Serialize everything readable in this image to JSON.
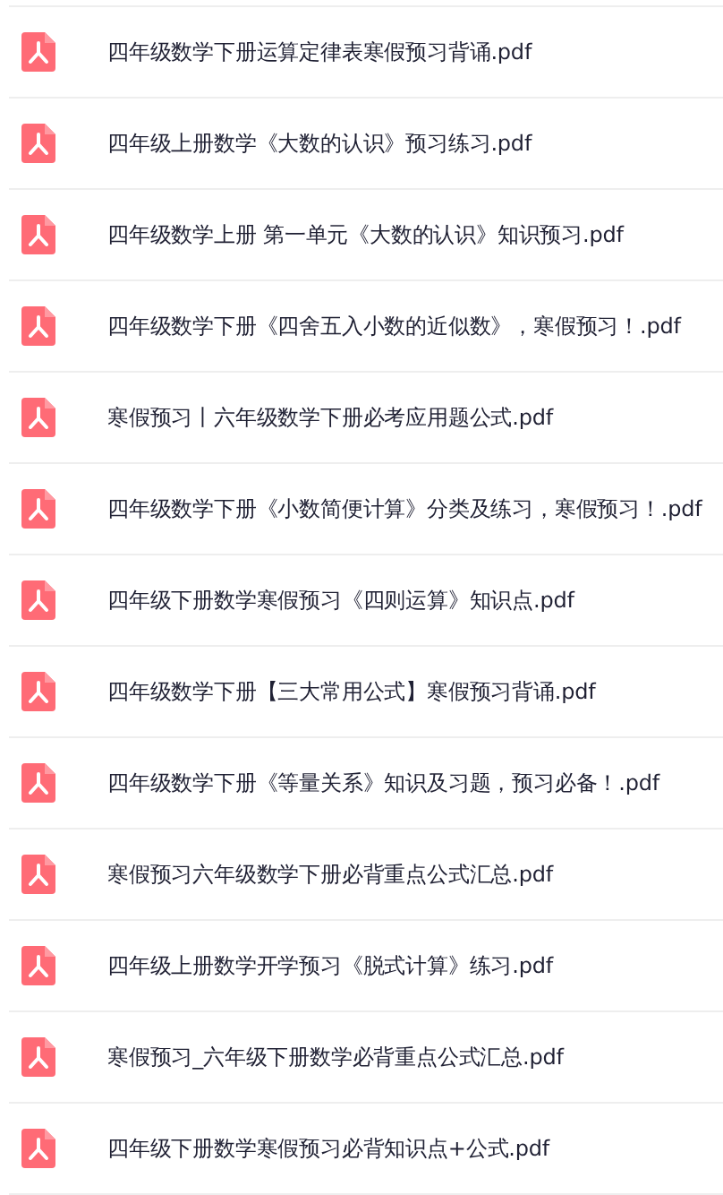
{
  "files": [
    {
      "name": "四年级数学下册运算定律表寒假预习背诵.pdf"
    },
    {
      "name": "四年级上册数学《大数的认识》预习练习.pdf"
    },
    {
      "name": "四年级数学上册 第一单元《大数的认识》知识预习.pdf"
    },
    {
      "name": "四年级数学下册《四舍五入小数的近似数》，寒假预习！.pdf"
    },
    {
      "name": "寒假预习丨六年级数学下册必考应用题公式.pdf"
    },
    {
      "name": "四年级数学下册《小数简便计算》分类及练习，寒假预习！.pdf"
    },
    {
      "name": "四年级下册数学寒假预习《四则运算》知识点.pdf"
    },
    {
      "name": "四年级数学下册【三大常用公式】寒假预习背诵.pdf"
    },
    {
      "name": "四年级数学下册《等量关系》知识及习题，预习必备！.pdf"
    },
    {
      "name": "寒假预习六年级数学下册必背重点公式汇总.pdf"
    },
    {
      "name": "四年级上册数学开学预习《脱式计算》练习.pdf"
    },
    {
      "name": "寒假预习_六年级下册数学必背重点公式汇总.pdf"
    },
    {
      "name": "四年级下册数学寒假预习必背知识点+公式.pdf"
    }
  ]
}
